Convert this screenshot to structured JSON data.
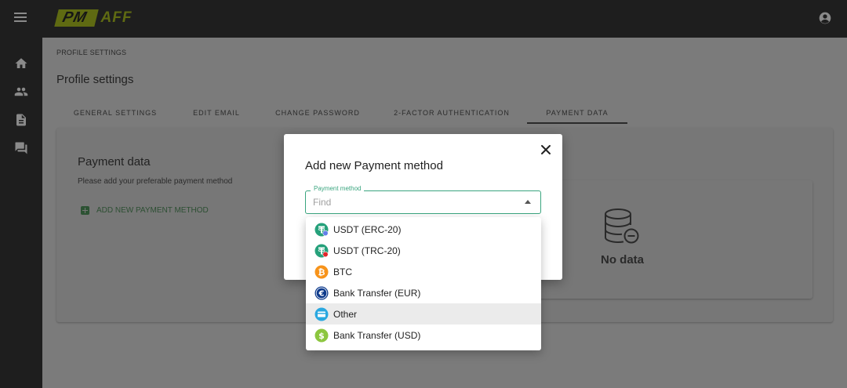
{
  "header": {
    "logo_left": "PM",
    "logo_right": "AFF",
    "brand_color": "#5f6a12"
  },
  "sidebar": {
    "items": [
      {
        "name": "home",
        "icon": "home-icon"
      },
      {
        "name": "users",
        "icon": "people-icon"
      },
      {
        "name": "documents",
        "icon": "document-icon"
      },
      {
        "name": "messages",
        "icon": "chat-icon"
      }
    ]
  },
  "breadcrumb": "PROFILE SETTINGS",
  "page_title": "Profile settings",
  "tabs": [
    {
      "label": "GENERAL SETTINGS",
      "active": false
    },
    {
      "label": "EDIT EMAIL",
      "active": false
    },
    {
      "label": "CHANGE PASSWORD",
      "active": false
    },
    {
      "label": "2-FACTOR AUTHENTICATION",
      "active": false
    },
    {
      "label": "PAYMENT DATA",
      "active": true
    }
  ],
  "payment_card": {
    "title": "Payment data",
    "subtitle": "Please add your preferable payment method",
    "add_button": "ADD NEW PAYMENT METHOD",
    "empty_text": "No data"
  },
  "modal": {
    "title": "Add new Payment method",
    "field_label": "Payment method",
    "field_value": "",
    "field_placeholder": "Find",
    "accent_color": "#3aa57f",
    "options": [
      {
        "label": "USDT (ERC-20)",
        "icon": "usdt-erc20-icon",
        "color": "#26a17b"
      },
      {
        "label": "USDT (TRC-20)",
        "icon": "usdt-trc20-icon",
        "color": "#26a17b"
      },
      {
        "label": "BTC",
        "icon": "bitcoin-icon",
        "color": "#f7931a"
      },
      {
        "label": "Bank Transfer (EUR)",
        "icon": "euro-icon",
        "color": "#0e3b8c"
      },
      {
        "label": "Other",
        "icon": "card-icon",
        "color": "#29a8e0"
      },
      {
        "label": "Bank Transfer (USD)",
        "icon": "dollar-icon",
        "color": "#8cc63f"
      }
    ]
  }
}
